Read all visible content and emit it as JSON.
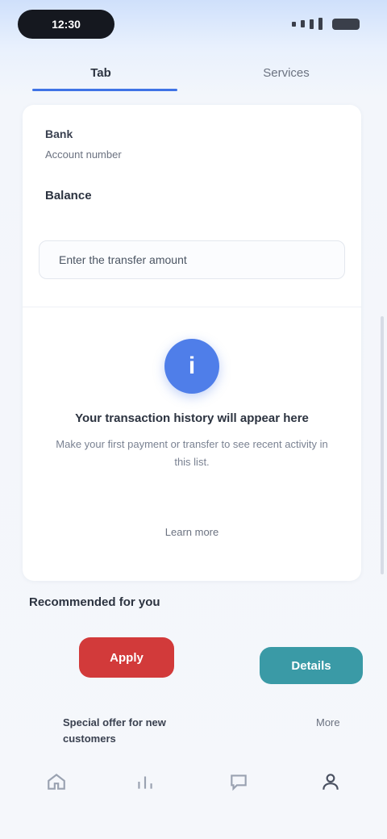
{
  "status_bar": {
    "time": "12:30"
  },
  "tabs": [
    {
      "label": "Tab"
    },
    {
      "label": "Services"
    }
  ],
  "card": {
    "meta_label": "Bank",
    "meta_sub": "Account number",
    "meta_strong": "Balance",
    "field_text": "Enter the transfer amount",
    "badge_glyph": "i",
    "empty_title": "Your transaction history will appear here",
    "empty_desc": "Make your first payment or transfer to see recent activity in this list.",
    "empty_link": "Learn more"
  },
  "section": {
    "title": "Recommended for you"
  },
  "actions": {
    "primary_label": "Apply",
    "secondary_label": "Details"
  },
  "promo": {
    "text": "Special offer for new customers",
    "right_text": "More"
  },
  "colors": {
    "accent": "#3f73e6",
    "badge": "#4f7ee9",
    "danger": "#d23a3a",
    "teal": "#3a9aa6"
  },
  "nav": {
    "icons": [
      "home-icon",
      "chart-icon",
      "chat-icon",
      "profile-icon"
    ]
  }
}
